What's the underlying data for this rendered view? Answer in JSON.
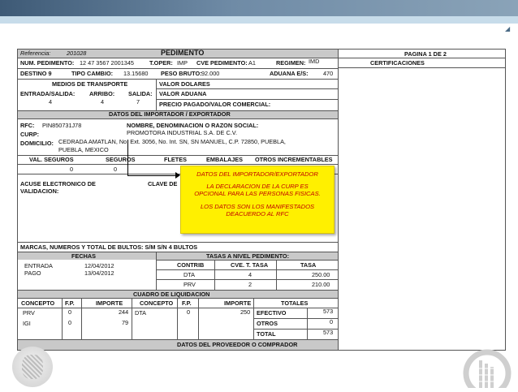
{
  "header": {
    "referencia_label": "Referencia:",
    "referencia_value": "201028",
    "title": "PEDIMENTO",
    "pagina": "PAGINA 1 DE 2",
    "certificaciones": "CERTIFICACIONES"
  },
  "row_num": {
    "num_label": "NUM. PEDIMENTO:",
    "num_value": "12   47   3567   2001345",
    "toper_label": "T.OPER:",
    "toper_value": "IMP",
    "cve_label": "CVE PEDIMENTO:",
    "cve_value": "A1",
    "regimen_label": "REGIMEN:",
    "regimen_value": "IMD"
  },
  "row_destino": {
    "destino": "DESTINO 9",
    "tipo_label": "TIPO CAMBIO:",
    "tipo_value": "13.15680",
    "peso_label": "PESO BRUTO:",
    "peso_value": "92.000",
    "aduana_label": "ADUANA E/S:",
    "aduana_value": "470"
  },
  "transporte": {
    "title": "MEDIOS DE TRANSPORTE",
    "entrada_label": "ENTRADA/SALIDA:",
    "entrada_value": "4",
    "arribo_label": "ARRIBO:",
    "arribo_value": "4",
    "salida_label": "SALIDA:",
    "salida_value": "7",
    "valor_dolares": "VALOR DOLARES",
    "valor_aduana": "VALOR ADUANA",
    "precio_pagado": "PRECIO PAGADO/VALOR COMERCIAL:"
  },
  "importador": {
    "section": "DATOS DEL IMPORTADOR / EXPORTADOR",
    "rfc_label": "RFC:",
    "rfc_value": "PIN850731J78",
    "nombre_label": "NOMBRE, DENOMINACION O RAZON SOCIAL:",
    "curp_label": "CURP:",
    "nombre_value": "PROMOTORA INDUSTRIAL S.A. DE C.V.",
    "domicilio_label": "DOMICILIO:",
    "domicilio_line1": "CEDRADA AMATLAN, No. Ext. 3056, No. Int. SN, SN   MANUEL, C.P. 72850,   PUEBLA,",
    "domicilio_line2": "PUEBLA, MEXICO"
  },
  "valores": {
    "val_seguros": "VAL. SEGUROS",
    "seguros": "SEGUROS",
    "fletes": "FLETES",
    "embalajes": "EMBALAJES",
    "otros": "OTROS INCREMENTABLES",
    "val_seguros_value": "0",
    "seguros_value": "0"
  },
  "acuse": {
    "line1": "ACUSE ELECTRONICO DE",
    "line2": "VALIDACION:",
    "clave": "CLAVE DE"
  },
  "marcas": "MARCAS, NUMEROS Y TOTAL DE BULTOS: S/M S/N 4 BULTOS",
  "fechas": {
    "title": "FECHAS",
    "entrada_label": "ENTRADA",
    "entrada_value": "12/04/2012",
    "pago_label": "PAGO",
    "pago_value": "13/04/2012"
  },
  "tasas": {
    "title": "TASAS A NIVEL PEDIMENTO:",
    "headers": [
      "CONTRIB",
      "CVE. T. TASA",
      "TASA"
    ],
    "rows": [
      [
        "DTA",
        "4",
        "250.00"
      ],
      [
        "PRV",
        "2",
        "210.00"
      ]
    ]
  },
  "liquidacion": {
    "title": "CUADRO DE LIQUIDACION",
    "headers": [
      "CONCEPTO",
      "F.P.",
      "IMPORTE",
      "CONCEPTO",
      "F.P.",
      "IMPORTE",
      "TOTALES"
    ],
    "rows": [
      [
        "PRV",
        "0",
        "244",
        "DTA",
        "0",
        "250"
      ],
      [
        "IGI",
        "0",
        "79",
        "",
        "",
        ""
      ]
    ],
    "totales": [
      [
        "EFECTIVO",
        "573"
      ],
      [
        "OTROS",
        "0"
      ],
      [
        "TOTAL",
        "573"
      ]
    ]
  },
  "proveedor": "DATOS DEL PROVEEDOR O COMPRADOR",
  "note": {
    "p1": "DATOS DEL IMPORTADOR/EXPORTADOR",
    "p2": "LA DECLARACION DE LA CURP ES OPCIONAL PARA LAS PERSONAS FISICAS.",
    "p3": "LOS DATOS SON LOS MANIFESTADOS DEACUERDO AL RFC"
  },
  "colors": {
    "note_bg": "#fff000",
    "note_text": "#c00000",
    "section_bar": "#c9c9c9",
    "topbar": "#3e5a76"
  },
  "icons": [
    "arrow-corner-icon",
    "logo-left-emblem",
    "logo-right-emblem"
  ]
}
